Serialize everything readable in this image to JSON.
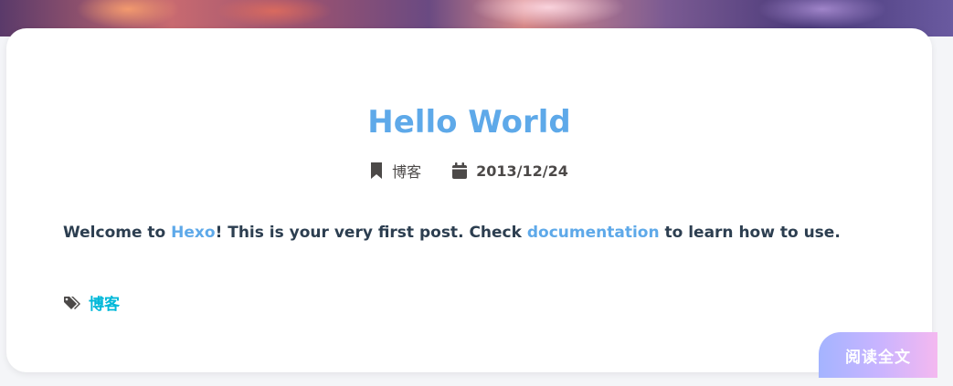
{
  "colors": {
    "title": "#5ea9e9",
    "link": "#5ea9e9",
    "tag": "#00b8d9",
    "meta_text": "#4c4948",
    "body_text": "#2c3e50"
  },
  "post": {
    "title": "Hello World",
    "meta": {
      "category_icon": "bookmark-icon",
      "category": "博客",
      "date_icon": "calendar-icon",
      "date": "2013/12/24"
    },
    "excerpt": {
      "part1": "Welcome to ",
      "link1": "Hexo",
      "part2": "! This is your very first post. Check ",
      "link2": "documentation",
      "part3": " to learn how to use."
    },
    "tags_icon": "tags-icon",
    "tags": [
      "博客"
    ],
    "read_more_label": "阅读全文"
  }
}
